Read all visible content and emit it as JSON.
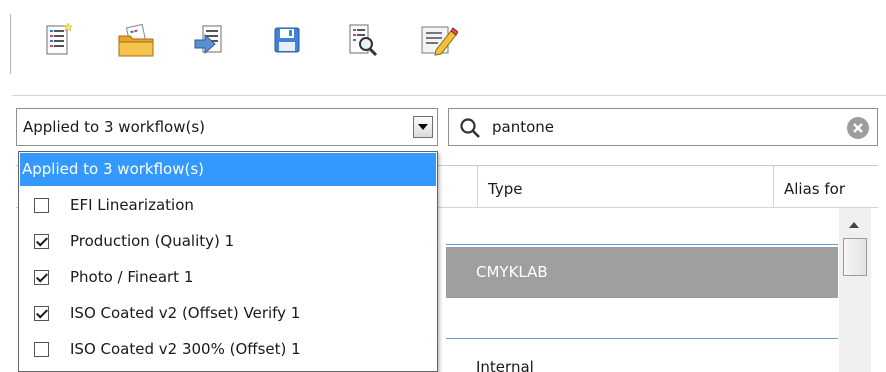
{
  "toolbar": {
    "buttons": [
      {
        "name": "new-list",
        "icon": "new-document-icon"
      },
      {
        "name": "open",
        "icon": "open-folder-icon"
      },
      {
        "name": "import",
        "icon": "import-arrow-icon"
      },
      {
        "name": "save",
        "icon": "floppy-disk-icon"
      },
      {
        "name": "find",
        "icon": "document-search-icon"
      },
      {
        "name": "edit",
        "icon": "edit-pencil-icon"
      }
    ]
  },
  "filter": {
    "selected": "Applied to 3 workflow(s)"
  },
  "search": {
    "value": "pantone",
    "icon": "magnifier-icon",
    "clear_icon": "clear-circle-icon"
  },
  "table": {
    "columns": [
      "Type",
      "Alias for"
    ],
    "rows": [
      {
        "type": "CMYKLAB",
        "selected": true
      },
      {
        "type": "Internal",
        "selected": false
      }
    ]
  },
  "dropdown": {
    "header": "Applied to 3 workflow(s)",
    "items": [
      {
        "label": "EFI Linearization",
        "checked": false
      },
      {
        "label": "Production (Quality) 1",
        "checked": true
      },
      {
        "label": "Photo / Fineart 1",
        "checked": true
      },
      {
        "label": "ISO Coated v2 (Offset) Verify 1",
        "checked": true
      },
      {
        "label": "ISO Coated v2 300% (Offset) 1",
        "checked": false
      }
    ]
  },
  "colors": {
    "selection_blue": "#3399ff",
    "row_selected_gray": "#9f9f9f",
    "row_rule_blue": "#5aa0d8"
  }
}
